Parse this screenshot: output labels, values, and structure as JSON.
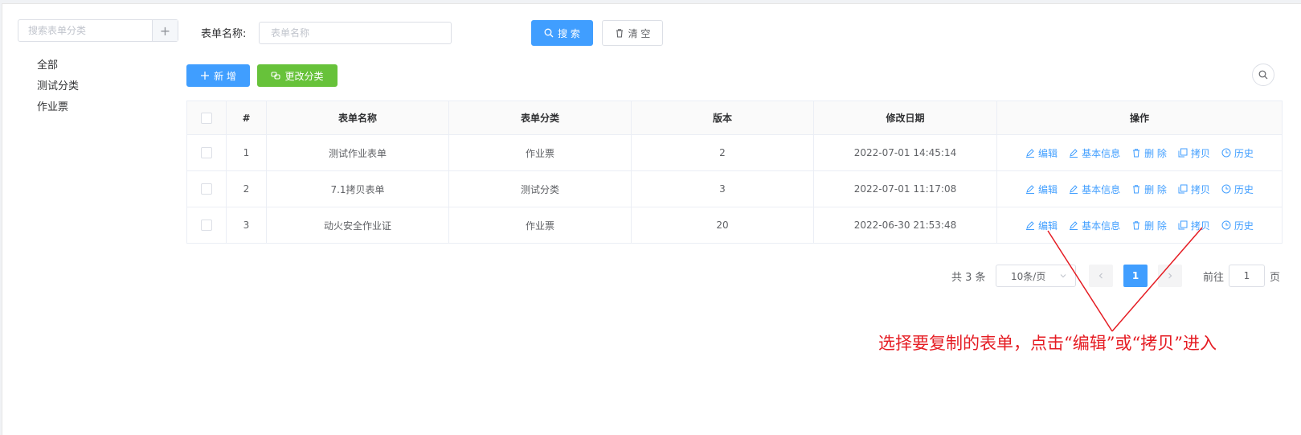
{
  "sidebar": {
    "search_placeholder": "搜索表单分类",
    "add_label": "+",
    "categories": [
      "全部",
      "测试分类",
      "作业票"
    ]
  },
  "search": {
    "label": "表单名称:",
    "placeholder": "表单名称",
    "search_label": "搜 索",
    "clear_label": "清 空"
  },
  "toolbar": {
    "add_label": "新 增",
    "change_category_label": "更改分类"
  },
  "table": {
    "headers": [
      "#",
      "表单名称",
      "表单分类",
      "版本",
      "修改日期",
      "操作"
    ],
    "rows": [
      {
        "index": "1",
        "name": "测试作业表单",
        "category": "作业票",
        "version": "2",
        "date": "2022-07-01 14:45:14"
      },
      {
        "index": "2",
        "name": "7.1拷贝表单",
        "category": "测试分类",
        "version": "3",
        "date": "2022-07-01 11:17:08"
      },
      {
        "index": "3",
        "name": "动火安全作业证",
        "category": "作业票",
        "version": "20",
        "date": "2022-06-30 21:53:48"
      }
    ],
    "actions": [
      "编辑",
      "基本信息",
      "删 除",
      "拷贝",
      "历史"
    ]
  },
  "pagination": {
    "total": "共 3 条",
    "page_size": "10条/页",
    "current": "1",
    "goto_label": "前往",
    "goto_value": "1",
    "page_label": "页"
  },
  "annotation": "选择要复制的表单，点击“编辑”或“拷贝”进入",
  "colors": {
    "primary": "#409eff",
    "success": "#67c23a",
    "annotation": "#e51c23"
  }
}
